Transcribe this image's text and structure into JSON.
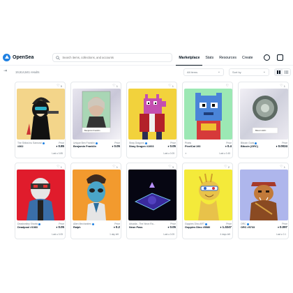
{
  "header": {
    "logo_text": "OpenSea",
    "search_placeholder": "Search items, collections, and accounts",
    "nav": [
      "Marketplace",
      "Stats",
      "Resources",
      "Create"
    ]
  },
  "toolbar": {
    "filter_icon": "filter-toggle-icon",
    "results_count": "19,614,641 results",
    "status_select": "All items",
    "sort_select": "Sort by"
  },
  "price_label": "Price",
  "cards": [
    {
      "fav": "5",
      "collection": "The Shiba Inu Samurai",
      "name": "#362",
      "price": "0.85",
      "footer_left": "",
      "footer_right": "Last ♦ 0.85"
    },
    {
      "fav": "1",
      "collection": "Unique Ben Franklin",
      "name": "Benjamin Franklin",
      "price": "0.05",
      "footer_left": "",
      "footer_right": ""
    },
    {
      "fav": "1",
      "collection": "Stray Dragons",
      "name": "Stray Dragon #1003",
      "price": "0.05",
      "footer_left": "",
      "footer_right": "Last ♦ 0.05"
    },
    {
      "fav": "",
      "collection": "Pixels",
      "name": "PixelCat 193",
      "price": "0.4",
      "footer_left": "",
      "footer_right": "Last ♦ 0.45"
    },
    {
      "fav": "1",
      "collection": "Bitcoin Gods",
      "name": "Bitcoin (GRC)",
      "price": "0.0024",
      "footer_left": "",
      "footer_right": ""
    },
    {
      "fav": "1",
      "collection": "Deadsmiley Sharks",
      "name": "Deadpool #1083",
      "price": "0.05",
      "footer_left": "",
      "footer_right": "Last ♦ 0.05"
    },
    {
      "fav": "1",
      "collection": "Alien Mechanites",
      "name": "Ralph",
      "price": "0.2",
      "footer_left": "",
      "footer_right": "1 day left"
    },
    {
      "fav": "3",
      "collection": "Arkadia - The Neon Ra...",
      "name": "Neon Pass",
      "price": "0.05",
      "footer_left": "",
      "footer_right": "Last ♦ 0.05"
    },
    {
      "fav": "2",
      "collection": "Goppies Dino ART",
      "name": "Goppies Dino #5580",
      "price": "1.3247",
      "footer_left": "",
      "footer_right": "4 days left"
    },
    {
      "fav": "1",
      "collection": "ORC",
      "name": "ORC #5733",
      "price": "0.097",
      "footer_left": "",
      "footer_right": "Last ♦ 0.1"
    }
  ],
  "labels": {
    "franklin_caption": "Benjamin Franklin",
    "bitcoin_caption": "Bitcoin GRC"
  },
  "colors": {
    "brand": "#2081e2",
    "text": "#04111d",
    "muted": "#707a83"
  }
}
